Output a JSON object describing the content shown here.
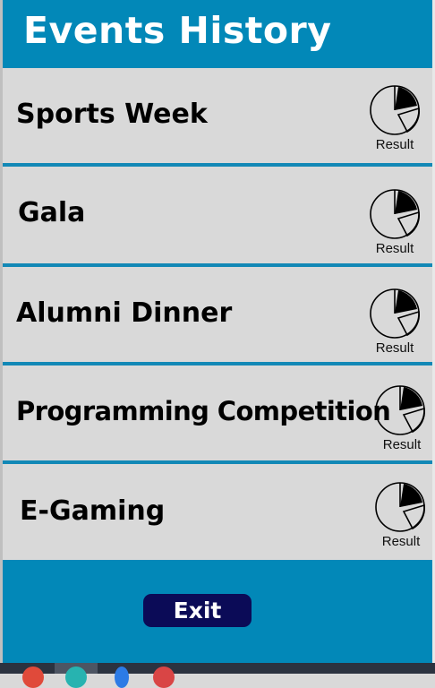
{
  "header": {
    "title": "Events History"
  },
  "events": [
    {
      "name": "Sports Week",
      "result_label": "Result"
    },
    {
      "name": "Gala",
      "result_label": "Result"
    },
    {
      "name": "Alumni Dinner",
      "result_label": "Result"
    },
    {
      "name": "Programming Competition",
      "result_label": "Result"
    },
    {
      "name": "E-Gaming",
      "result_label": "Result"
    }
  ],
  "footer": {
    "exit_label": "Exit"
  },
  "colors": {
    "header": "#0288b8",
    "row_bg": "#d9d9d9",
    "separator": "#1288b6",
    "exit_button": "#0b0b57"
  },
  "icons": {
    "result": "pie-chart-icon",
    "taskbar": [
      "red-app-icon",
      "teal-app-icon",
      "blue-app-icon",
      "red-app-icon"
    ]
  }
}
